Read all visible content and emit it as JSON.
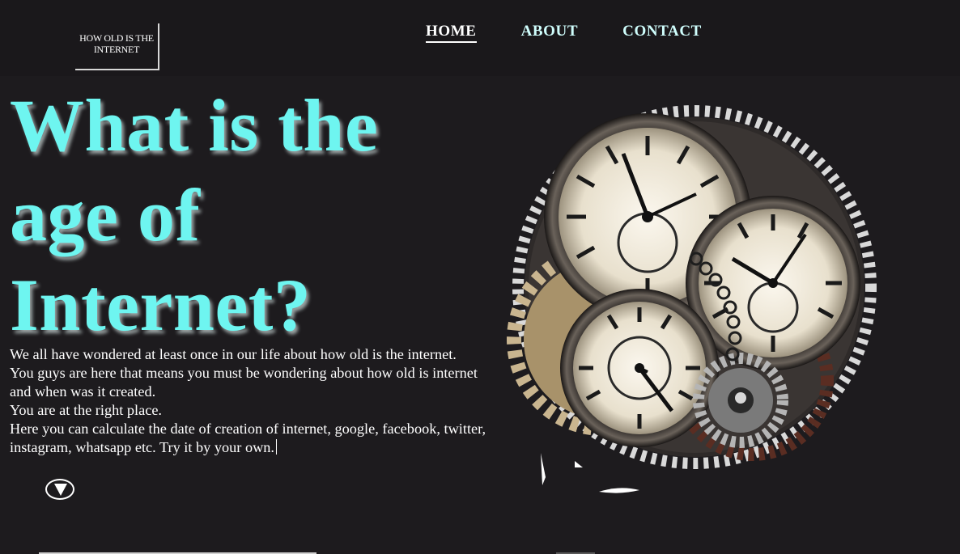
{
  "logo": {
    "line1": "HOW OLD IS THE",
    "line2": "INTERNET"
  },
  "nav": {
    "items": [
      {
        "label": "HOME",
        "active": true
      },
      {
        "label": "ABOUT",
        "active": false
      },
      {
        "label": "CONTACT",
        "active": false
      }
    ]
  },
  "hero": {
    "title_line1": "What is the",
    "title_line2": "age of",
    "title_line3": "Internet?",
    "title_color": "#6ef5f0"
  },
  "intro": {
    "p1": "We all have wondered at least once in our life about how old is the internet.",
    "p2": "You guys are here that means you must be wondering about how old is internet and when was it created.",
    "p3": "You are at the right place.",
    "p4": "Here you can calculate the date of creation of internet, google, facebook, twitter, instagram, whatsapp etc. Try it by your own."
  },
  "icons": {
    "scroll_down": "chevron-down-icon",
    "illustration": "clock-gears-illustration"
  },
  "colors": {
    "background": "#1d1b1e",
    "accent": "#6ef5f0",
    "nav_text": "#cffdfc"
  }
}
